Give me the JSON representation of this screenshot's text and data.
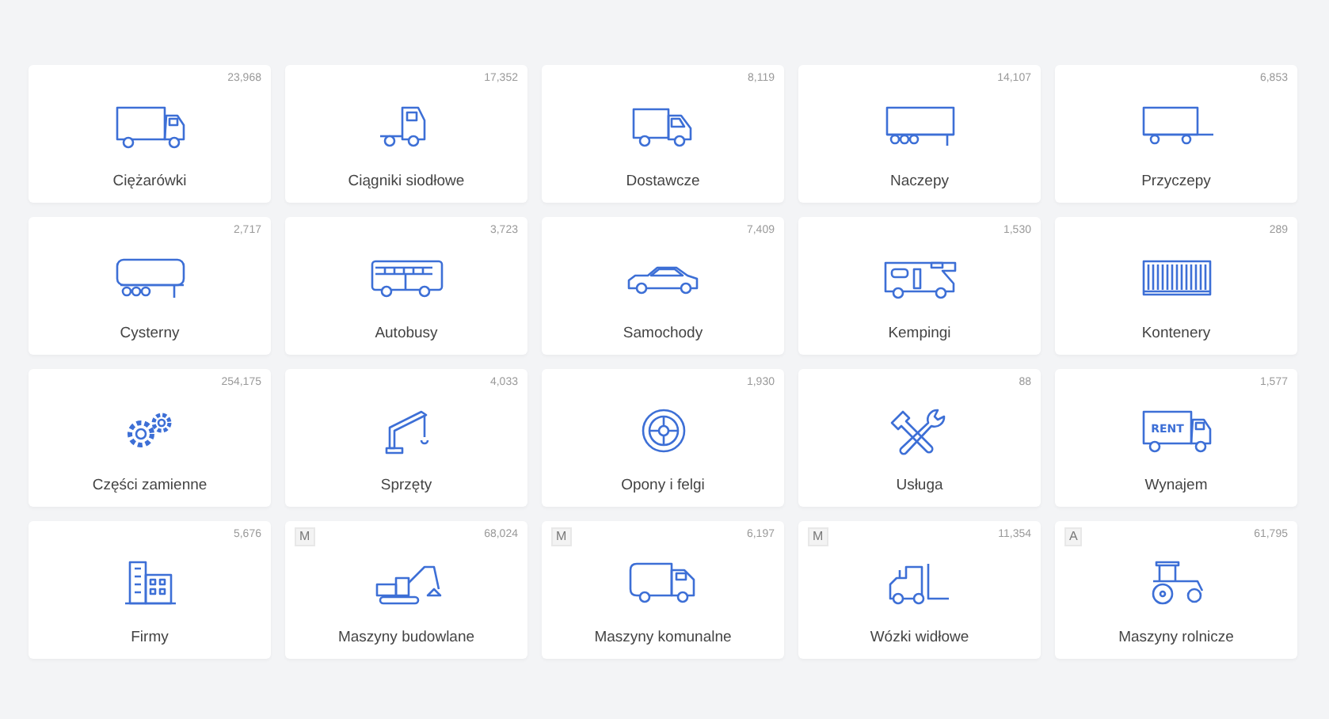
{
  "categories": [
    {
      "label": "Ciężarówki",
      "count": "23,968"
    },
    {
      "label": "Ciągniki siodłowe",
      "count": "17,352"
    },
    {
      "label": "Dostawcze",
      "count": "8,119"
    },
    {
      "label": "Naczepy",
      "count": "14,107"
    },
    {
      "label": "Przyczepy",
      "count": "6,853"
    },
    {
      "label": "Cysterny",
      "count": "2,717"
    },
    {
      "label": "Autobusy",
      "count": "3,723"
    },
    {
      "label": "Samochody",
      "count": "7,409"
    },
    {
      "label": "Kempingi",
      "count": "1,530"
    },
    {
      "label": "Kontenery",
      "count": "289"
    },
    {
      "label": "Części zamienne",
      "count": "254,175"
    },
    {
      "label": "Sprzęty",
      "count": "4,033"
    },
    {
      "label": "Opony i felgi",
      "count": "1,930"
    },
    {
      "label": "Usługa",
      "count": "88"
    },
    {
      "label": "Wynajem",
      "count": "1,577",
      "icon_text": "RENT"
    },
    {
      "label": "Firmy",
      "count": "5,676"
    },
    {
      "label": "Maszyny budowlane",
      "count": "68,024",
      "badge": "M"
    },
    {
      "label": "Maszyny komunalne",
      "count": "6,197",
      "badge": "M"
    },
    {
      "label": "Wózki widłowe",
      "count": "11,354",
      "badge": "M"
    },
    {
      "label": "Maszyny rolnicze",
      "count": "61,795",
      "badge": "A"
    }
  ]
}
